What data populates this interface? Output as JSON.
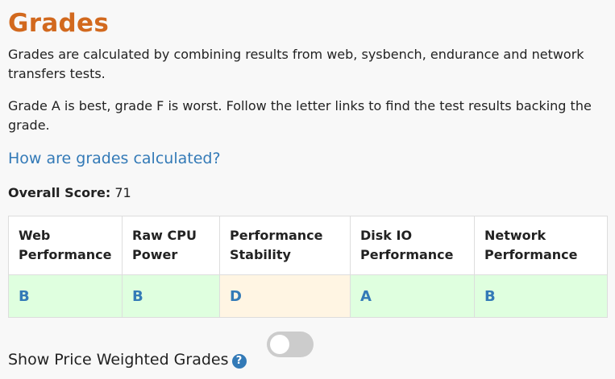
{
  "title": "Grades",
  "intro_text": "Grades are calculated by combining results from web, sysbench, endurance and network transfers tests.",
  "grade_text": "Grade A is best, grade F is worst. Follow the letter links to find the test results backing the grade.",
  "how_link": "How are grades calculated?",
  "overall_score": {
    "label": "Overall Score:",
    "value": "71"
  },
  "columns": [
    {
      "header": "Web Performance",
      "grade": "B",
      "bg": "#dfffdf"
    },
    {
      "header": "Raw CPU Power",
      "grade": "B",
      "bg": "#dfffdf"
    },
    {
      "header": "Performance Stability",
      "grade": "D",
      "bg": "#fff5e3"
    },
    {
      "header": "Disk IO Performance",
      "grade": "A",
      "bg": "#dfffdf"
    },
    {
      "header": "Network Performance",
      "grade": "B",
      "bg": "#dfffdf"
    }
  ],
  "toggle": {
    "label": "Show Price Weighted Grades",
    "checked": false,
    "help_icon": "question-circle-icon",
    "help_glyph": "?"
  },
  "colors": {
    "title": "#d2691e",
    "link": "#337ab7",
    "good_cell": "#dfffdf",
    "warn_cell": "#fff5e3",
    "toggle_off": "#cccccc"
  }
}
